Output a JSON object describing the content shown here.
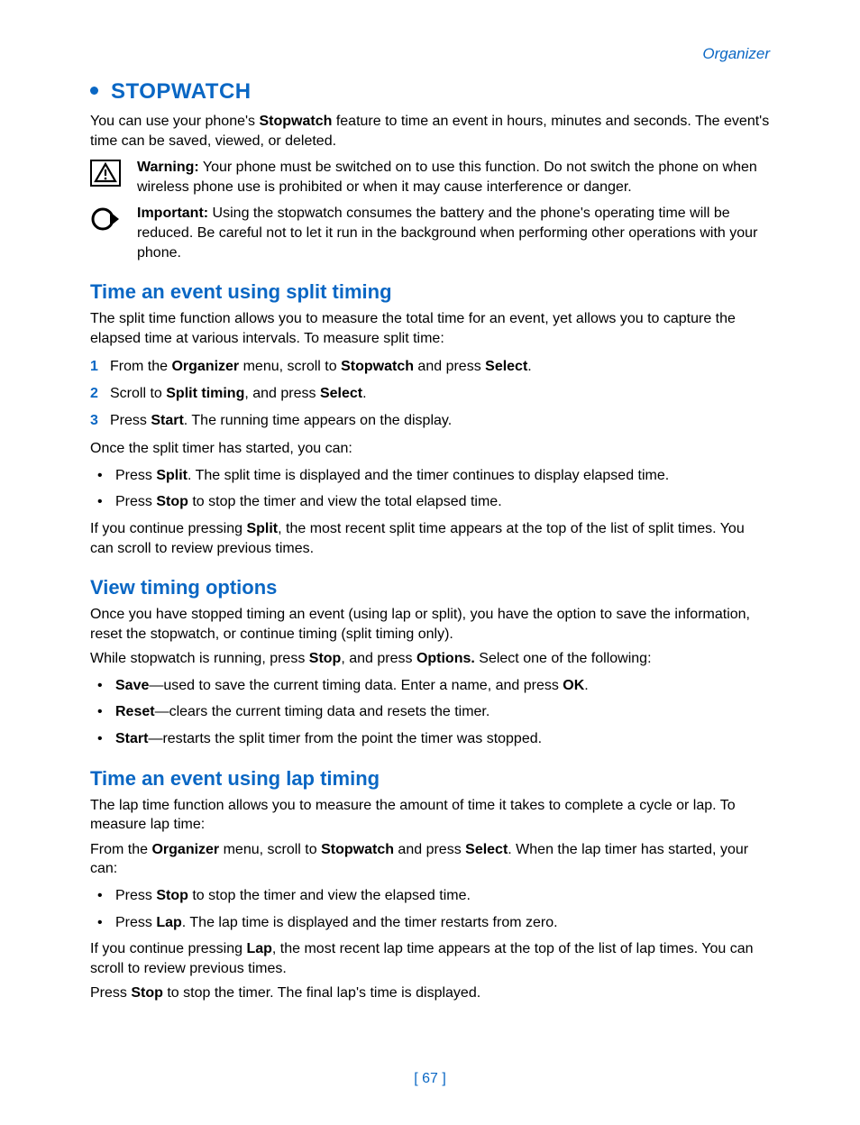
{
  "header": {
    "section": "Organizer"
  },
  "h1": {
    "title": "Stopwatch"
  },
  "intro": {
    "p1a": "You can use your phone's ",
    "p1b": "Stopwatch",
    "p1c": " feature to time an event in hours, minutes and seconds. The event's time can be saved, viewed, or deleted."
  },
  "warning": {
    "label": "Warning:",
    "text": " Your phone must be switched on to use this function. Do not switch the phone on when wireless phone use is prohibited or when it may cause interference or danger."
  },
  "important": {
    "label": "Important:",
    "text": " Using the stopwatch consumes the battery and the phone's operating time will be reduced. Be careful not to let it run in the background when performing other operations with your phone."
  },
  "split": {
    "heading": "Time an event using split timing",
    "intro": "The split time function allows you to measure the total time for an event, yet allows you to capture the elapsed time at various intervals. To measure split time:",
    "steps": {
      "s1a": "From the ",
      "s1b": "Organizer",
      "s1c": " menu, scroll to ",
      "s1d": "Stopwatch",
      "s1e": " and press ",
      "s1f": "Select",
      "s1g": ".",
      "s2a": "Scroll to ",
      "s2b": "Split timing",
      "s2c": ", and press ",
      "s2d": "Select",
      "s2e": ".",
      "s3a": "Press ",
      "s3b": "Start",
      "s3c": ". The running time appears on the display."
    },
    "after": "Once the split timer has started, you can:",
    "bullets": {
      "b1a": "Press ",
      "b1b": "Split",
      "b1c": ". The split time is displayed and the timer continues to display elapsed time.",
      "b2a": "Press ",
      "b2b": "Stop",
      "b2c": " to stop the timer and view the total elapsed time."
    },
    "tail_a": "If you continue pressing ",
    "tail_b": "Split",
    "tail_c": ", the most recent split time appears at the top of the list of split times. You can scroll to review previous times."
  },
  "view": {
    "heading": "View timing options",
    "p1": "Once you have stopped timing an event (using lap or split), you have the option to save the information, reset the stopwatch, or continue timing (split timing only).",
    "p2a": "While stopwatch is running, press ",
    "p2b": "Stop",
    "p2c": ", and press ",
    "p2d": "Options.",
    "p2e": " Select one of the following:",
    "bullets": {
      "b1a": "Save",
      "b1b": "—used to save the current timing data. Enter a name, and press ",
      "b1c": "OK",
      "b1d": ".",
      "b2a": "Reset",
      "b2b": "—clears the current timing data and resets the timer.",
      "b3a": "Start",
      "b3b": "—restarts the split timer from the point the timer was stopped."
    }
  },
  "lap": {
    "heading": "Time an event using lap timing",
    "intro": "The lap time function allows you to measure the amount of time it takes to complete a cycle or lap. To measure lap time:",
    "p2a": "From the ",
    "p2b": "Organizer",
    "p2c": " menu, scroll to ",
    "p2d": "Stopwatch",
    "p2e": " and press ",
    "p2f": "Select",
    "p2g": ". When the lap timer has started, your can:",
    "bullets": {
      "b1a": "Press ",
      "b1b": "Stop",
      "b1c": " to stop the timer and view the elapsed time.",
      "b2a": "Press ",
      "b2b": "Lap",
      "b2c": ". The lap time is displayed and the timer restarts from zero."
    },
    "tail_a": "If you continue pressing ",
    "tail_b": "Lap",
    "tail_c": ", the most recent lap time appears at the top of the list of lap times. You can scroll to review previous times.",
    "final_a": "Press ",
    "final_b": "Stop",
    "final_c": " to stop the timer. The final lap's time is displayed."
  },
  "footer": {
    "page": "[ 67 ]"
  }
}
